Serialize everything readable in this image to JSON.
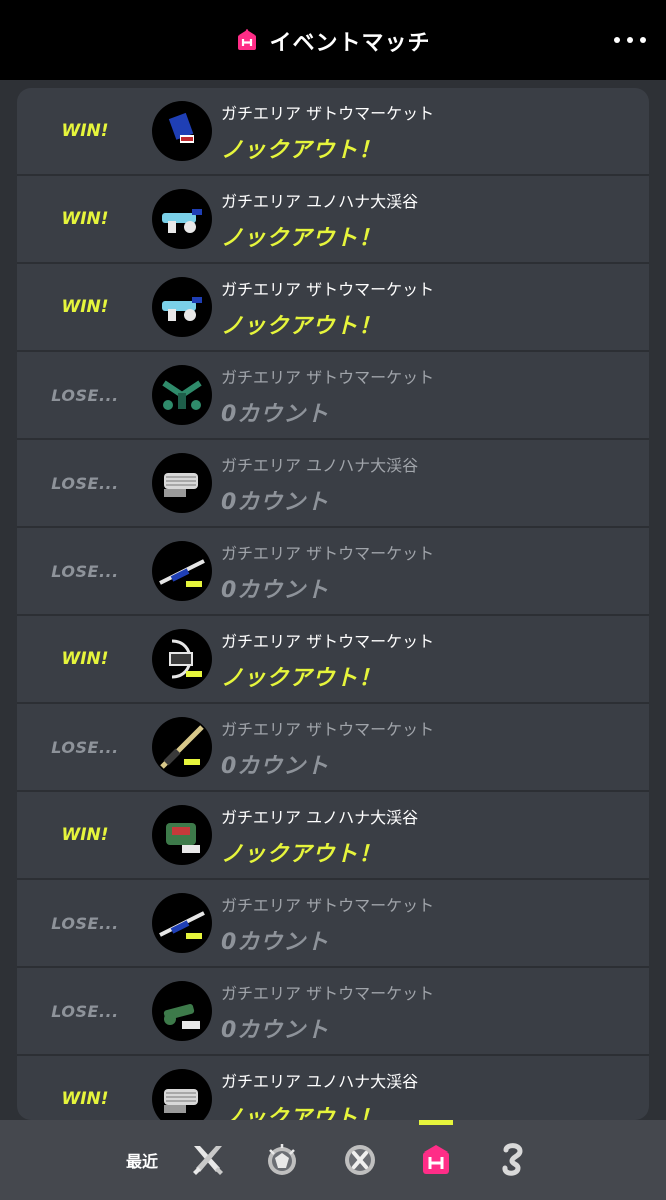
{
  "header": {
    "title": "イベントマッチ",
    "icon": "event-match-icon",
    "more_icon": "more-options-icon"
  },
  "colors": {
    "win": "#e6f53c",
    "lose": "#8e939a",
    "event_pink": "#ff2d87"
  },
  "matches": [
    {
      "result": "WIN!",
      "status": "win",
      "stage": "ガチエリア ザトウマーケット",
      "outcome": "ノックアウト！",
      "weapon_icon": "blaster-weapon-icon"
    },
    {
      "result": "WIN!",
      "status": "win",
      "stage": "ガチエリア ユノハナ大渓谷",
      "outcome": "ノックアウト！",
      "weapon_icon": "shooter-weapon-icon"
    },
    {
      "result": "WIN!",
      "status": "win",
      "stage": "ガチエリア ザトウマーケット",
      "outcome": "ノックアウト！",
      "weapon_icon": "shooter-weapon-icon"
    },
    {
      "result": "LOSE...",
      "status": "lose",
      "stage": "ガチエリア ザトウマーケット",
      "outcome": "0カウント",
      "weapon_icon": "dualies-weapon-icon"
    },
    {
      "result": "LOSE...",
      "status": "lose",
      "stage": "ガチエリア ユノハナ大渓谷",
      "outcome": "0カウント",
      "weapon_icon": "splatling-weapon-icon"
    },
    {
      "result": "LOSE...",
      "status": "lose",
      "stage": "ガチエリア ザトウマーケット",
      "outcome": "0カウント",
      "weapon_icon": "charger-weapon-icon"
    },
    {
      "result": "WIN!",
      "status": "win",
      "stage": "ガチエリア ザトウマーケット",
      "outcome": "ノックアウト！",
      "weapon_icon": "stringer-weapon-icon"
    },
    {
      "result": "LOSE...",
      "status": "lose",
      "stage": "ガチエリア ザトウマーケット",
      "outcome": "0カウント",
      "weapon_icon": "splatana-weapon-icon"
    },
    {
      "result": "WIN!",
      "status": "win",
      "stage": "ガチエリア ユノハナ大渓谷",
      "outcome": "ノックアウト！",
      "weapon_icon": "slosher-weapon-icon"
    },
    {
      "result": "LOSE...",
      "status": "lose",
      "stage": "ガチエリア ザトウマーケット",
      "outcome": "0カウント",
      "weapon_icon": "charger-weapon-icon"
    },
    {
      "result": "LOSE...",
      "status": "lose",
      "stage": "ガチエリア ザトウマーケット",
      "outcome": "0カウント",
      "weapon_icon": "brush-weapon-icon"
    },
    {
      "result": "WIN!",
      "status": "win",
      "stage": "ガチエリア ユノハナ大渓谷",
      "outcome": "ノックアウト！",
      "weapon_icon": "splatling-weapon-icon"
    }
  ],
  "nav": {
    "recent_label": "最近",
    "items": [
      {
        "icon": "regular-battle-icon",
        "active": false
      },
      {
        "icon": "anarchy-battle-icon",
        "active": false
      },
      {
        "icon": "x-battle-icon",
        "active": false
      },
      {
        "icon": "event-match-icon",
        "active": true
      },
      {
        "icon": "private-battle-icon",
        "active": false
      }
    ]
  }
}
